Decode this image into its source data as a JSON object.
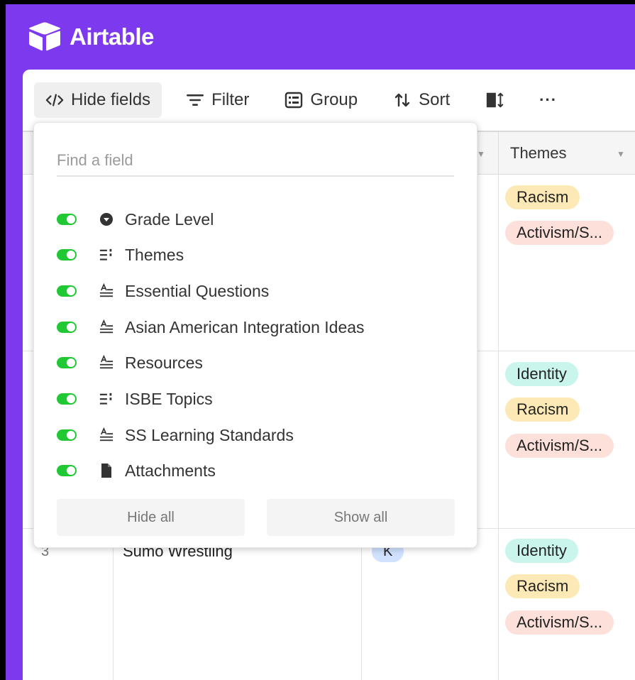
{
  "app": {
    "name": "Airtable",
    "accent_color": "#7c39ed"
  },
  "toolbar": {
    "hide_fields_label": "Hide fields",
    "filter_label": "Filter",
    "group_label": "Group",
    "sort_label": "Sort",
    "row_height_icon": "row-height-icon",
    "more_label": "···"
  },
  "grid": {
    "themes_header": "Themes",
    "rows": [
      {
        "number": "",
        "name": "",
        "grade": "",
        "themes": [
          "Racism",
          "Activism/S..."
        ]
      },
      {
        "number": "",
        "name": "",
        "grade": "",
        "themes": [
          "Identity",
          "Racism",
          "Activism/S..."
        ]
      },
      {
        "number": "3",
        "name": "Sumo Wrestling",
        "grade": "K",
        "themes": [
          "Identity",
          "Racism",
          "Activism/S..."
        ]
      }
    ]
  },
  "popover": {
    "search_placeholder": "Find a field",
    "fields": [
      {
        "name": "Grade Level",
        "icon": "single-select-icon",
        "visible": true
      },
      {
        "name": "Themes",
        "icon": "multi-select-icon",
        "visible": true
      },
      {
        "name": "Essential Questions",
        "icon": "long-text-icon",
        "visible": true
      },
      {
        "name": "Asian American Integration Ideas",
        "icon": "long-text-icon",
        "visible": true
      },
      {
        "name": "Resources",
        "icon": "long-text-icon",
        "visible": true
      },
      {
        "name": "ISBE Topics",
        "icon": "multi-select-icon",
        "visible": true
      },
      {
        "name": "SS Learning Standards",
        "icon": "long-text-icon",
        "visible": true
      },
      {
        "name": "Attachments",
        "icon": "attachment-icon",
        "visible": true
      }
    ],
    "hide_all_label": "Hide all",
    "show_all_label": "Show all"
  }
}
